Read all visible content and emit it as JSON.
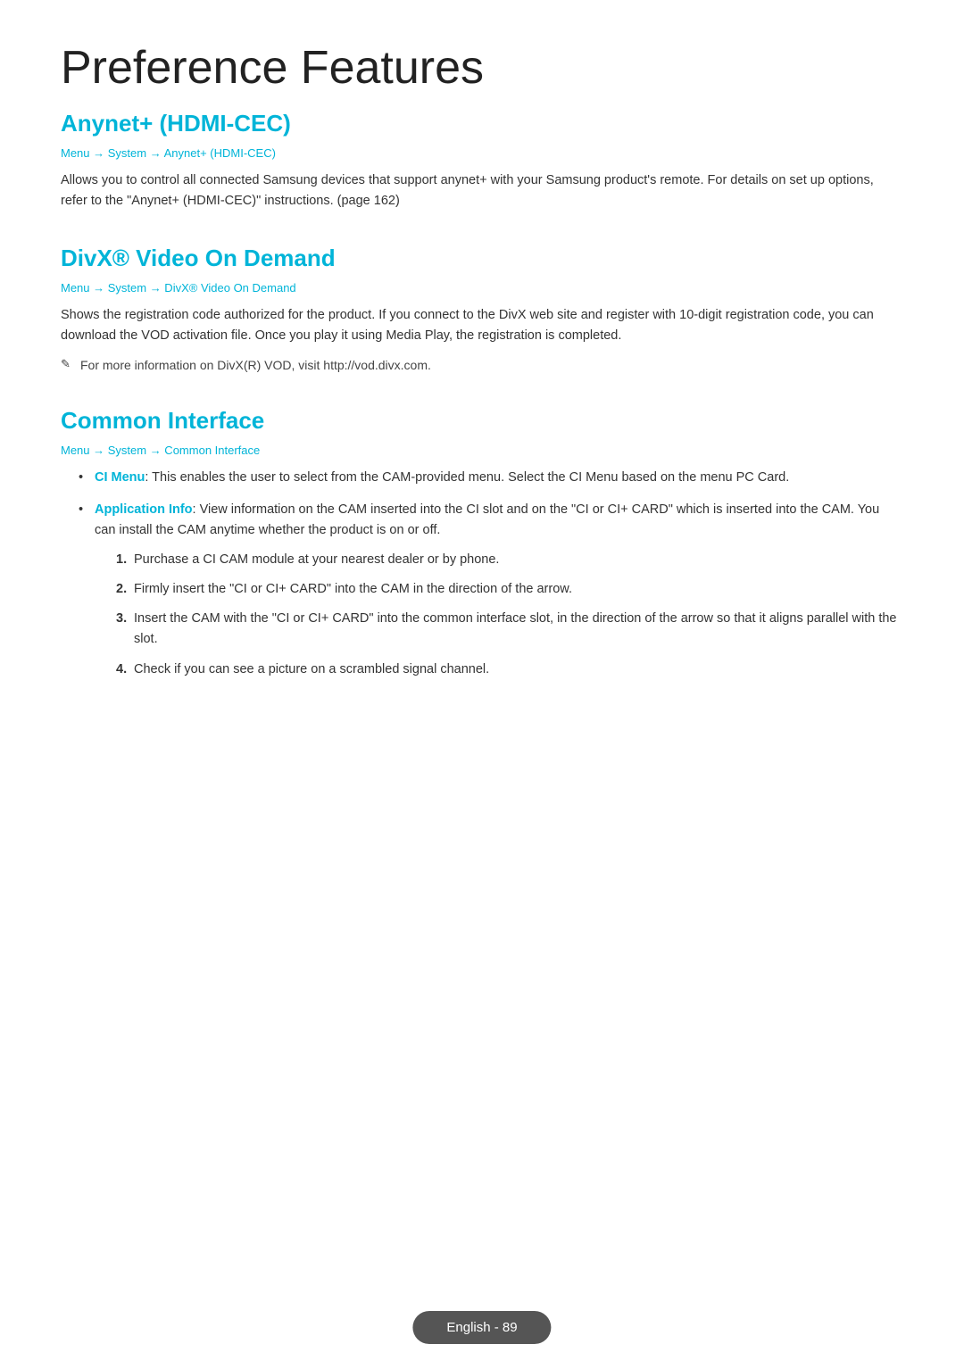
{
  "page": {
    "title": "Preference Features"
  },
  "sections": {
    "anynet": {
      "heading": "Anynet+ (HDMI-CEC)",
      "breadcrumb": "Menu → System → Anynet+ (HDMI-CEC)",
      "body": "Allows you to control all connected Samsung devices that support anynet+ with your Samsung product's remote. For details on set up options, refer to the \"Anynet+ (HDMI-CEC)\" instructions. (page 162)"
    },
    "divx": {
      "heading": "DivX® Video On Demand",
      "breadcrumb": "Menu → System → DivX® Video On Demand",
      "body": "Shows the registration code authorized for the product. If you connect to the DivX web site and register with 10-digit registration code, you can download the VOD activation file. Once you play it using Media Play, the registration is completed.",
      "note": "For more information on DivX(R) VOD, visit http://vod.divx.com."
    },
    "common_interface": {
      "heading": "Common Interface",
      "breadcrumb": "Menu → System → Common Interface",
      "bullets": [
        {
          "term": "CI Menu",
          "text": ": This enables the user to select from the CAM-provided menu. Select the CI Menu based on the menu PC Card."
        },
        {
          "term": "Application Info",
          "text": ": View information on the CAM inserted into the CI slot and on the \"CI or CI+ CARD\" which is inserted into the CAM. You can install the CAM anytime whether the product is on or off.",
          "sub_steps": [
            "Purchase a CI CAM module at your nearest dealer or by phone.",
            "Firmly insert the \"CI or CI+ CARD\" into the CAM in the direction of the arrow.",
            "Insert the CAM with the \"CI or CI+ CARD\" into the common interface slot, in the direction of the arrow so that it aligns parallel with the slot.",
            "Check if you can see a picture on a scrambled signal channel."
          ]
        }
      ]
    }
  },
  "footer": {
    "label": "English - 89"
  }
}
